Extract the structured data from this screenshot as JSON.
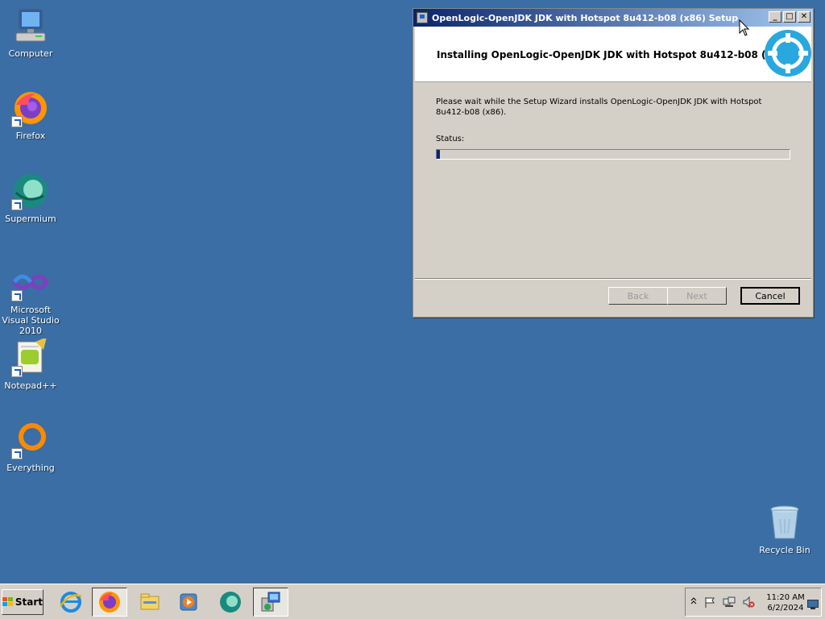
{
  "desktop": {
    "icons": [
      {
        "label": "Computer"
      },
      {
        "label": "Firefox"
      },
      {
        "label": "Supermium"
      },
      {
        "label": "Microsoft Visual Studio 2010"
      },
      {
        "label": "Notepad++"
      },
      {
        "label": "Everything"
      },
      {
        "label": "Recycle Bin"
      }
    ]
  },
  "window": {
    "title": "OpenLogic-OpenJDK JDK with Hotspot 8u412-b08 (x86) Setup",
    "header_title": "Installing OpenLogic-OpenJDK JDK with Hotspot 8u412-b08 (x86)",
    "description": "Please wait while the Setup Wizard installs OpenLogic-OpenJDK JDK with Hotspot 8u412-b08 (x86).",
    "status_label": "Status:",
    "progress_fraction": 0.01,
    "buttons": {
      "back": "Back",
      "next": "Next",
      "cancel": "Cancel"
    },
    "controls": {
      "minimize": "_",
      "maximize": "□",
      "close": "✕"
    }
  },
  "taskbar": {
    "start_label": "Start",
    "apps": [
      "internet-explorer",
      "firefox",
      "file-explorer",
      "media-player",
      "supermium",
      "setup-installer"
    ],
    "clock": {
      "time": "11:20 AM",
      "date": "6/2/2024"
    }
  }
}
